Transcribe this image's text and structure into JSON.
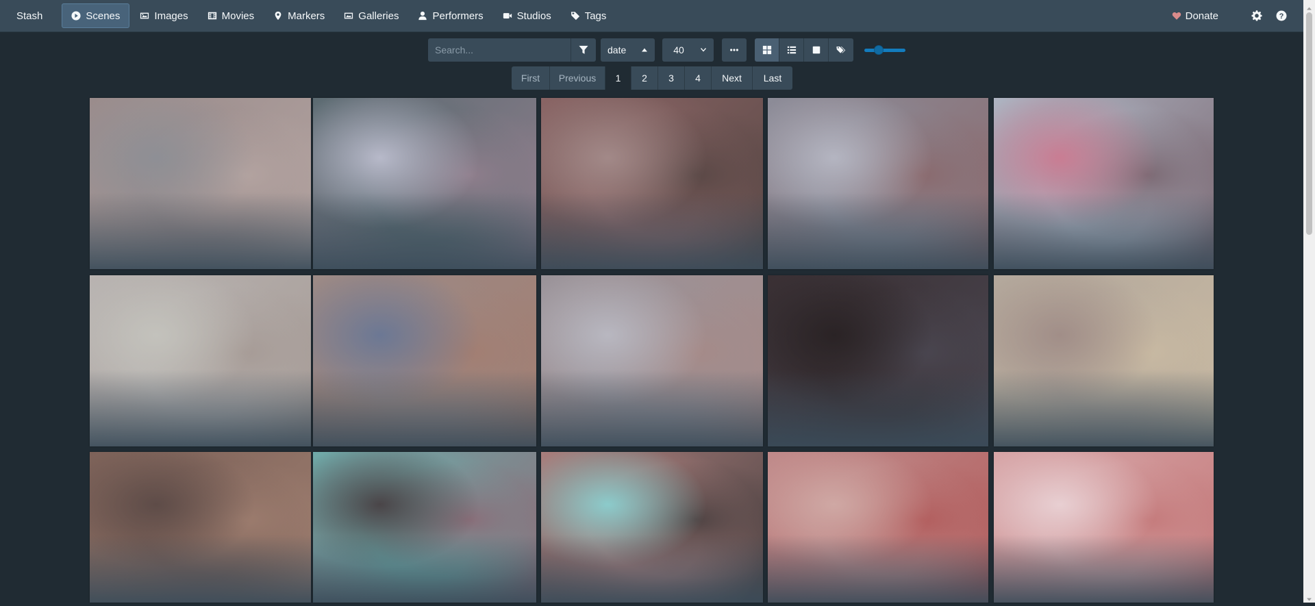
{
  "navbar": {
    "brand": "Stash",
    "items": [
      {
        "label": "Scenes",
        "icon": "play-circle-icon",
        "active": true
      },
      {
        "label": "Images",
        "icon": "image-icon"
      },
      {
        "label": "Movies",
        "icon": "film-icon"
      },
      {
        "label": "Markers",
        "icon": "map-marker-icon"
      },
      {
        "label": "Galleries",
        "icon": "images-icon"
      },
      {
        "label": "Performers",
        "icon": "user-icon"
      },
      {
        "label": "Studios",
        "icon": "video-icon"
      },
      {
        "label": "Tags",
        "icon": "tag-icon"
      }
    ],
    "donate_label": "Donate"
  },
  "toolbar": {
    "search_placeholder": "Search...",
    "sort_by": "date",
    "per_page": "40",
    "zoom_level_fraction": 0.3
  },
  "pagination": {
    "first": "First",
    "previous": "Previous",
    "pages": [
      "1",
      "2",
      "3",
      "4"
    ],
    "current": "1",
    "next": "Next",
    "last": "Last"
  },
  "scenes": [
    {
      "colors": [
        "#9a8c8c",
        "#b3a3a0",
        "#8e8f95"
      ]
    },
    {
      "colors": [
        "#5c6b72",
        "#8f7e8c",
        "#b7b9c9"
      ]
    },
    {
      "colors": [
        "#8a6565",
        "#5a4846",
        "#a28988"
      ]
    },
    {
      "colors": [
        "#8c8c98",
        "#8a6a6e",
        "#b4b5c1"
      ]
    },
    {
      "colors": [
        "#aeb4c2",
        "#7c6a74",
        "#c97d93"
      ]
    },
    {
      "colors": [
        "#b8b3b1",
        "#a69b96",
        "#c3c2bc"
      ]
    },
    {
      "colors": [
        "#9c8a86",
        "#a27e72",
        "#6c7894"
      ]
    },
    {
      "colors": [
        "#9a9399",
        "#a58a88",
        "#b8b7c0"
      ]
    },
    {
      "colors": [
        "#3a3034",
        "#4a4650",
        "#2a2325"
      ]
    },
    {
      "colors": [
        "#b3a89c",
        "#c8b9a2",
        "#a18e88"
      ]
    },
    {
      "colors": [
        "#7d6259",
        "#9c7c6e",
        "#5e4c48"
      ]
    },
    {
      "colors": [
        "#6fa9a8",
        "#8a6f7a",
        "#4a4548"
      ]
    },
    {
      "colors": [
        "#a87e7c",
        "#4f4343",
        "#8ccbcb"
      ]
    },
    {
      "colors": [
        "#c08b8b",
        "#b25e5e",
        "#cfa8a4"
      ]
    },
    {
      "colors": [
        "#d7a6a8",
        "#c47a7b",
        "#e8cfd2"
      ]
    }
  ]
}
